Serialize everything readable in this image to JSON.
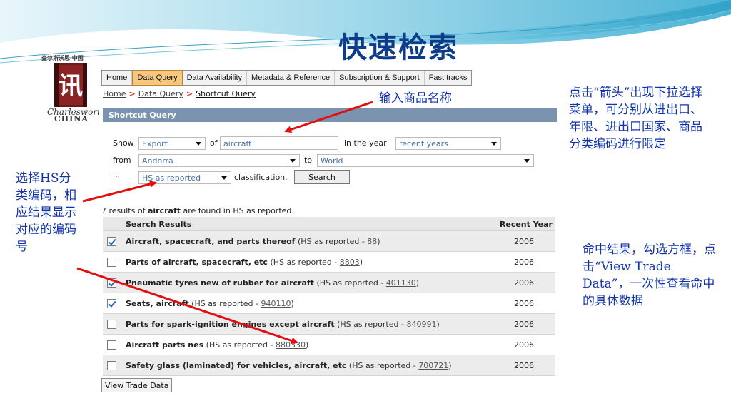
{
  "slide": {
    "title": "快速检索"
  },
  "logo": {
    "caption": "查尔斯沃思·中国",
    "name": "Charlesworth",
    "country": "CHINA",
    "glyph": "讯"
  },
  "nav": {
    "tabs": [
      "Home",
      "Data Query",
      "Data Availability",
      "Metadata & Reference",
      "Subscription & Support",
      "Fast tracks"
    ],
    "active": "Data Query"
  },
  "breadcrumb": {
    "items": [
      "Home",
      "Data Query",
      "Shortcut Query"
    ],
    "separator": ">"
  },
  "section": {
    "title": "Shortcut Query"
  },
  "form": {
    "show_label": "Show",
    "flow_value": "Export",
    "of_label": "of",
    "commodity_value": "aircraft",
    "year_label": "in the year",
    "year_value": "recent years",
    "from_label": "from",
    "reporter_value": "Andorra",
    "to_label": "to",
    "partner_value": "World",
    "in_label": "in",
    "classification_value": "HS as reported",
    "classification_suffix": "classification.",
    "search_label": "Search"
  },
  "results": {
    "summary_count": "7",
    "summary_pre": " results of ",
    "summary_term": "aircraft",
    "summary_post": " are found in HS as reported.",
    "col_results": "Search Results",
    "col_year": "Recent Year",
    "rows": [
      {
        "name": "Aircraft, spacecraft, and parts thereof",
        "cls": " (HS as reported - ",
        "code": "88",
        "close": ")",
        "year": "2006",
        "checked": true
      },
      {
        "name": "Parts of aircraft, spacecraft, etc",
        "cls": " (HS as reported - ",
        "code": "8803",
        "close": ")",
        "year": "2006",
        "checked": false
      },
      {
        "name": "Pneumatic tyres new of rubber for aircraft",
        "cls": " (HS as reported - ",
        "code": "401130",
        "close": ")",
        "year": "2006",
        "checked": true
      },
      {
        "name": "Seats, aircraft",
        "cls": " (HS as reported - ",
        "code": "940110",
        "close": ")",
        "year": "2006",
        "checked": true
      },
      {
        "name": "Parts for spark-ignition engines except aircraft",
        "cls": " (HS as reported - ",
        "code": "840991",
        "close": ")",
        "year": "2006",
        "checked": false
      },
      {
        "name": "Aircraft parts nes",
        "cls": " (HS as reported - ",
        "code": "880330",
        "close": ")",
        "year": "2006",
        "checked": false
      },
      {
        "name": "Safety glass (laminated) for vehicles, aircraft, etc",
        "cls": " (HS as reported - ",
        "code": "700721",
        "close": ")",
        "year": "2006",
        "checked": false
      }
    ],
    "view_button": "View Trade Data"
  },
  "annotations": {
    "input_hint": "输入商品名称",
    "left_note": "选择HS分类编码，相应结果显示对应的编码号",
    "right_note_1": "点击“箭头”出现下拉选择菜单，可分别从进出口、年限、进出口国家、商品分类编码进行限定",
    "right_note_2": "命中结果，勾选方框，点击“View Trade Data”，一次性查看命中的具体数据"
  },
  "colors": {
    "title": "#0d3d8a",
    "annotation": "#1133aa",
    "arrow": "#e01010",
    "section_bar": "#7b93ae",
    "active_tab": "#f6c77c"
  }
}
